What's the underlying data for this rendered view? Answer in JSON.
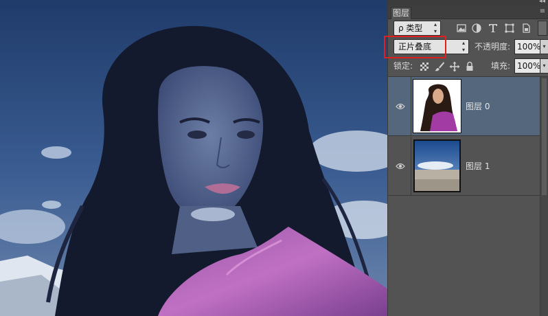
{
  "panel": {
    "collapse_glyph": "◂◂",
    "tab_label": "图层",
    "menu_icon": "panel-menu-icon",
    "filter": {
      "value": "ρ 类型",
      "icons": [
        "image-filter-icon",
        "adjustment-filter-icon",
        "type-filter-icon",
        "shape-filter-icon",
        "smart-object-filter-icon"
      ]
    },
    "blend_mode": {
      "value": "正片叠底"
    },
    "opacity": {
      "label": "不透明度:",
      "value": "100%"
    },
    "lock": {
      "label": "锁定:",
      "icons": [
        "lock-transparent-icon",
        "lock-paint-icon",
        "lock-position-icon",
        "lock-all-icon"
      ]
    },
    "fill": {
      "label": "填充:",
      "value": "100%"
    },
    "layers": [
      {
        "name": "图层 0",
        "visible": true,
        "selected": true,
        "thumb": "woman-portrait"
      },
      {
        "name": "图层 1",
        "visible": true,
        "selected": false,
        "thumb": "sky-mountain"
      }
    ]
  },
  "colors": {
    "highlight": "#e21f1f",
    "selected_layer": "#55677d",
    "panel_bg": "#535353"
  }
}
